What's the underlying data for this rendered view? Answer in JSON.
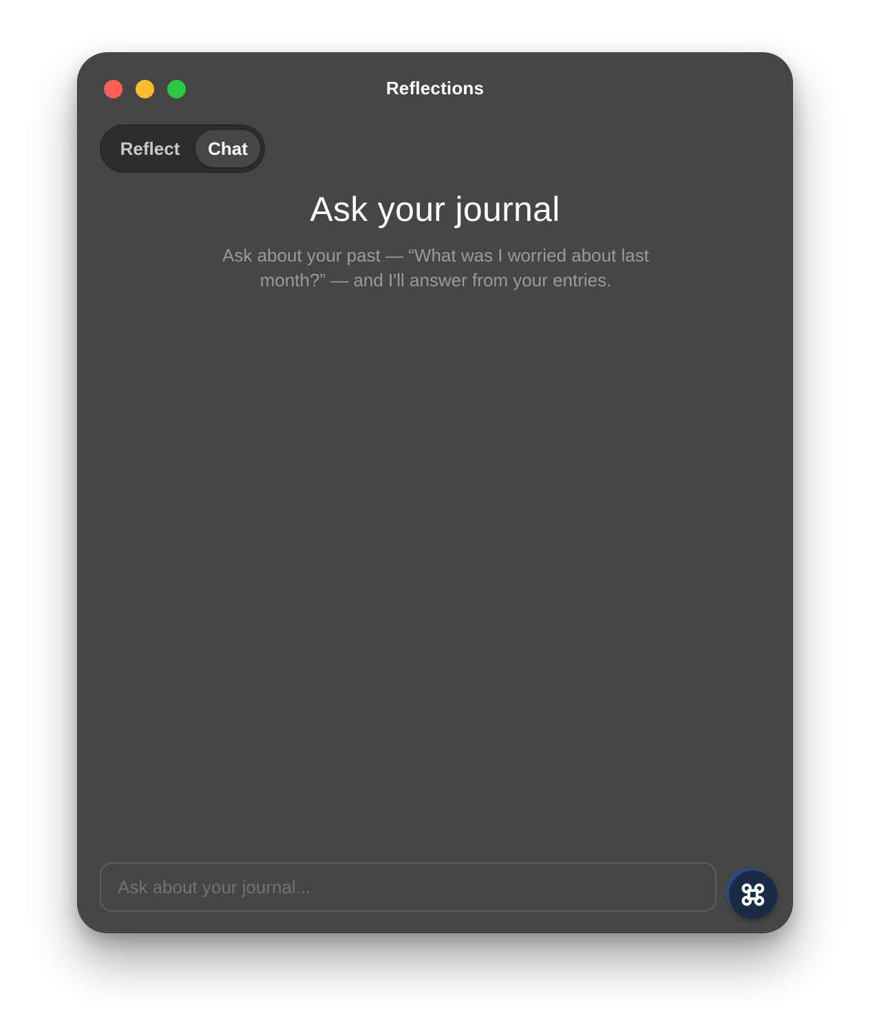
{
  "window": {
    "title": "Reflections"
  },
  "tabs": [
    {
      "label": "Reflect",
      "selected": false
    },
    {
      "label": "Chat",
      "selected": true
    }
  ],
  "main": {
    "heading": "Ask your journal",
    "subtext": "Ask about your past — “What was I worried about last month?” — and I'll answer from your entries."
  },
  "composer": {
    "placeholder": "Ask about your journal...",
    "value": "",
    "send_icon": "command-key-icon"
  },
  "colors": {
    "window_bg": "#464646",
    "close": "#fe5f57",
    "minimize": "#febc2e",
    "zoom": "#28c840",
    "send_button": "#1b2a45"
  }
}
